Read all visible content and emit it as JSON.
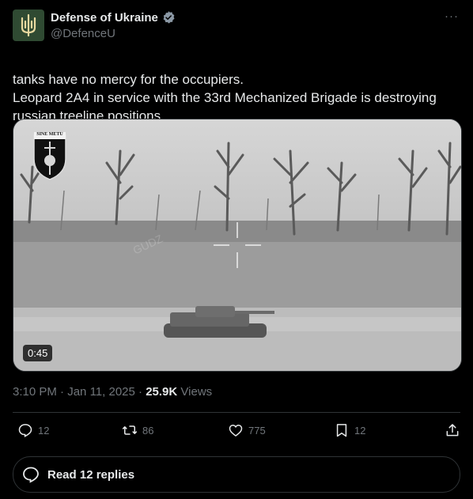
{
  "author": {
    "name": "Defense of Ukraine",
    "handle": "@DefenceU",
    "verified": true
  },
  "post": {
    "line1": "tanks have no mercy for the occupiers.",
    "line2": "Leopard 2A4 in service with the 33rd Mechanized Brigade is destroying russian treeline positions.",
    "flag_icon": "ukraine-flag-icon"
  },
  "media": {
    "duration": "0:45",
    "patch_text": "SINE METU",
    "watermark": "GUDZ"
  },
  "meta": {
    "time": "3:10 PM",
    "date": "Jan 11, 2025",
    "separator": "·",
    "views_count": "25.9K",
    "views_label": "Views"
  },
  "actions": {
    "replies": "12",
    "reposts": "86",
    "likes": "775",
    "bookmarks": "12"
  },
  "replies_button": {
    "label": "Read 12 replies"
  },
  "colors": {
    "background": "#000000",
    "text": "#e7e9ea",
    "muted": "#71767b",
    "border": "#2f3336",
    "verified": "#8b98a5",
    "flag_blue": "#0057b7",
    "flag_yellow": "#ffd700"
  }
}
